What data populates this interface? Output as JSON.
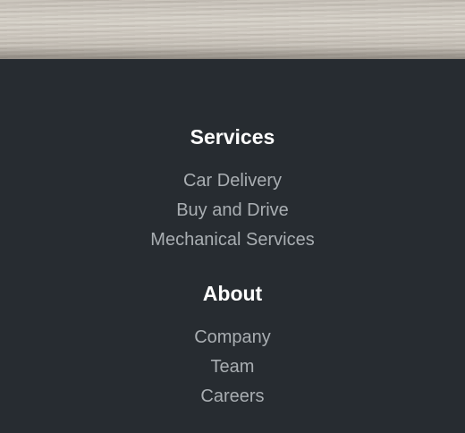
{
  "footer": {
    "services": {
      "heading": "Services",
      "links": [
        "Car Delivery",
        "Buy and Drive",
        "Mechanical Services"
      ]
    },
    "about": {
      "heading": "About",
      "links": [
        "Company",
        "Team",
        "Careers"
      ]
    }
  },
  "colors": {
    "background": "#272c31",
    "heading": "#ffffff",
    "link": "#a9aeb2"
  }
}
